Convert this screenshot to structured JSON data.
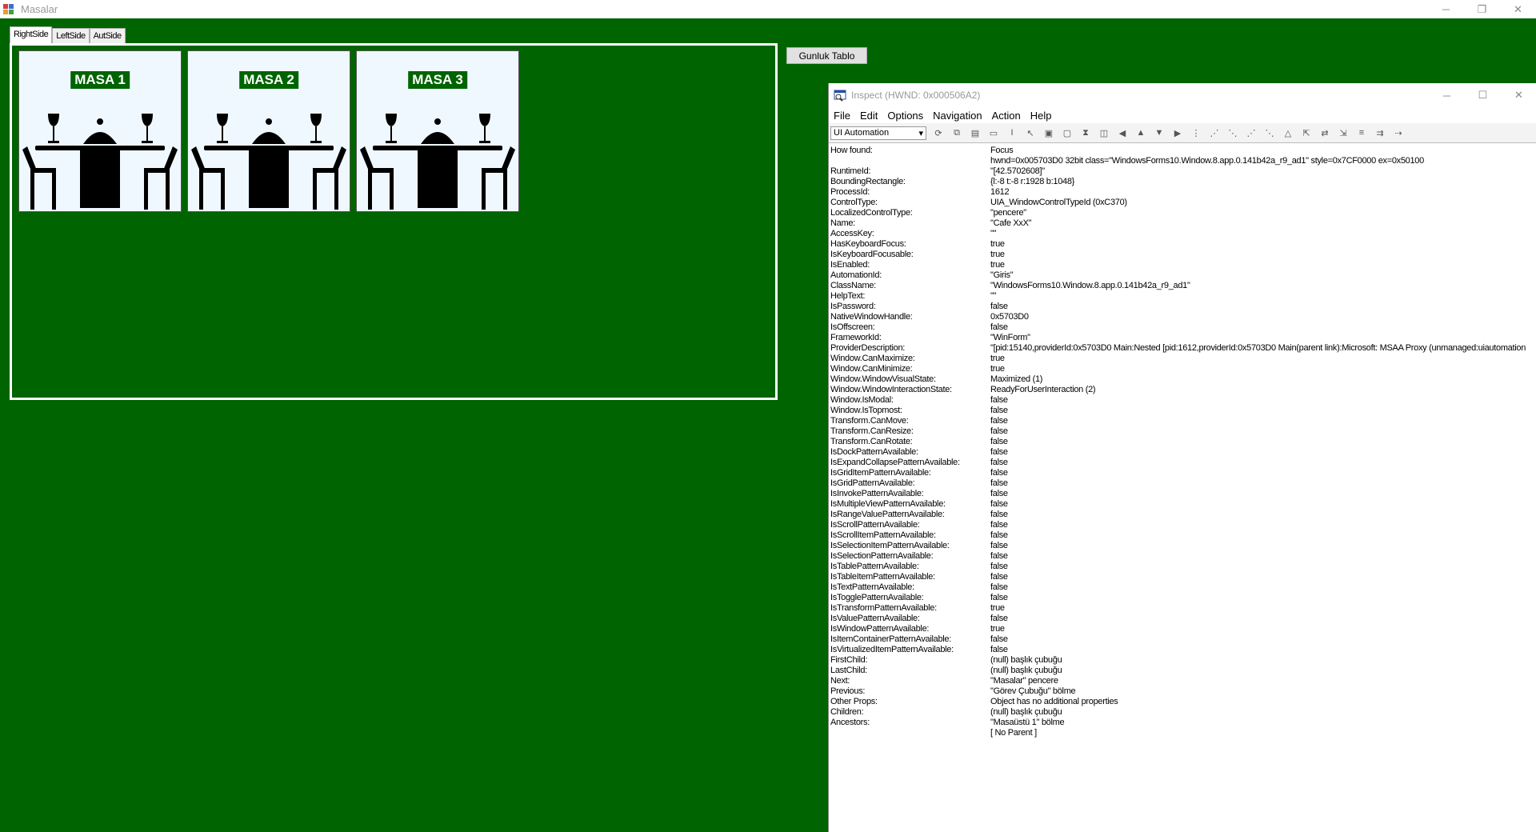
{
  "window": {
    "title": "Masalar",
    "controls": {
      "minimize": "─",
      "restore": "❐",
      "close": "✕"
    }
  },
  "tabs": [
    {
      "label": "RightSide",
      "selected": true
    },
    {
      "label": "LeftSide",
      "selected": false
    },
    {
      "label": "AutSide",
      "selected": false
    }
  ],
  "tables": [
    {
      "label": "MASA 1"
    },
    {
      "label": "MASA 2"
    },
    {
      "label": "MASA 3"
    }
  ],
  "gunluk_button": "Gunluk Tablo",
  "inspect": {
    "title": "Inspect  (HWND: 0x000506A2)",
    "controls": {
      "minimize": "─",
      "maximize": "☐",
      "close": "✕"
    },
    "menu": [
      "File",
      "Edit",
      "Options",
      "Navigation",
      "Action",
      "Help"
    ],
    "mode_select": "UI Automation",
    "properties": [
      {
        "k": "How found:",
        "v": "Focus"
      },
      {
        "k": "",
        "v": "hwnd=0x005703D0 32bit class=\"WindowsForms10.Window.8.app.0.141b42a_r9_ad1\" style=0x7CF0000 ex=0x50100"
      },
      {
        "k": "RuntimeId:",
        "v": "\"[42.5702608]\""
      },
      {
        "k": "BoundingRectangle:",
        "v": "{l:-8 t:-8 r:1928 b:1048}"
      },
      {
        "k": "ProcessId:",
        "v": "1612"
      },
      {
        "k": "ControlType:",
        "v": "UIA_WindowControlTypeId (0xC370)"
      },
      {
        "k": "LocalizedControlType:",
        "v": "\"pencere\""
      },
      {
        "k": "Name:",
        "v": "\"Cafe XxX\""
      },
      {
        "k": "AccessKey:",
        "v": "\"\""
      },
      {
        "k": "HasKeyboardFocus:",
        "v": "true"
      },
      {
        "k": "IsKeyboardFocusable:",
        "v": "true"
      },
      {
        "k": "IsEnabled:",
        "v": "true"
      },
      {
        "k": "AutomationId:",
        "v": "\"Giris\""
      },
      {
        "k": "ClassName:",
        "v": "\"WindowsForms10.Window.8.app.0.141b42a_r9_ad1\""
      },
      {
        "k": "HelpText:",
        "v": "\"\""
      },
      {
        "k": "IsPassword:",
        "v": "false"
      },
      {
        "k": "NativeWindowHandle:",
        "v": "0x5703D0"
      },
      {
        "k": "IsOffscreen:",
        "v": "false"
      },
      {
        "k": "FrameworkId:",
        "v": "\"WinForm\""
      },
      {
        "k": "ProviderDescription:",
        "v": "\"[pid:15140,providerId:0x5703D0 Main:Nested [pid:1612,providerId:0x5703D0 Main(parent link):Microsoft: MSAA Proxy (unmanaged:uiautomation"
      },
      {
        "k": "Window.CanMaximize:",
        "v": "true"
      },
      {
        "k": "Window.CanMinimize:",
        "v": "true"
      },
      {
        "k": "Window.WindowVisualState:",
        "v": "Maximized (1)"
      },
      {
        "k": "Window.WindowInteractionState:",
        "v": "ReadyForUserInteraction (2)"
      },
      {
        "k": "Window.IsModal:",
        "v": "false"
      },
      {
        "k": "Window.IsTopmost:",
        "v": "false"
      },
      {
        "k": "Transform.CanMove:",
        "v": "false"
      },
      {
        "k": "Transform.CanResize:",
        "v": "false"
      },
      {
        "k": "Transform.CanRotate:",
        "v": "false"
      },
      {
        "k": "IsDockPatternAvailable:",
        "v": "false"
      },
      {
        "k": "IsExpandCollapsePatternAvailable:",
        "v": "false"
      },
      {
        "k": "IsGridItemPatternAvailable:",
        "v": "false"
      },
      {
        "k": "IsGridPatternAvailable:",
        "v": "false"
      },
      {
        "k": "IsInvokePatternAvailable:",
        "v": "false"
      },
      {
        "k": "IsMultipleViewPatternAvailable:",
        "v": "false"
      },
      {
        "k": "IsRangeValuePatternAvailable:",
        "v": "false"
      },
      {
        "k": "IsScrollPatternAvailable:",
        "v": "false"
      },
      {
        "k": "IsScrollItemPatternAvailable:",
        "v": "false"
      },
      {
        "k": "IsSelectionItemPatternAvailable:",
        "v": "false"
      },
      {
        "k": "IsSelectionPatternAvailable:",
        "v": "false"
      },
      {
        "k": "IsTablePatternAvailable:",
        "v": "false"
      },
      {
        "k": "IsTableItemPatternAvailable:",
        "v": "false"
      },
      {
        "k": "IsTextPatternAvailable:",
        "v": "false"
      },
      {
        "k": "IsTogglePatternAvailable:",
        "v": "false"
      },
      {
        "k": "IsTransformPatternAvailable:",
        "v": "true"
      },
      {
        "k": "IsValuePatternAvailable:",
        "v": "false"
      },
      {
        "k": "IsWindowPatternAvailable:",
        "v": "true"
      },
      {
        "k": "IsItemContainerPatternAvailable:",
        "v": "false"
      },
      {
        "k": "IsVirtualizedItemPatternAvailable:",
        "v": "false"
      },
      {
        "k": "FirstChild:",
        "v": "(null) başlık çubuğu"
      },
      {
        "k": "LastChild:",
        "v": "(null) başlık çubuğu"
      },
      {
        "k": "Next:",
        "v": "\"Masalar\" pencere"
      },
      {
        "k": "Previous:",
        "v": "\"Görev Çubuğu\" bölme"
      },
      {
        "k": "Other Props:",
        "v": "Object has no additional properties"
      },
      {
        "k": "Children:",
        "v": "(null) başlık çubuğu"
      },
      {
        "k": "Ancestors:",
        "v": "\"Masaüstü 1\" bölme"
      },
      {
        "k": "",
        "v": "[ No Parent ]"
      }
    ]
  }
}
